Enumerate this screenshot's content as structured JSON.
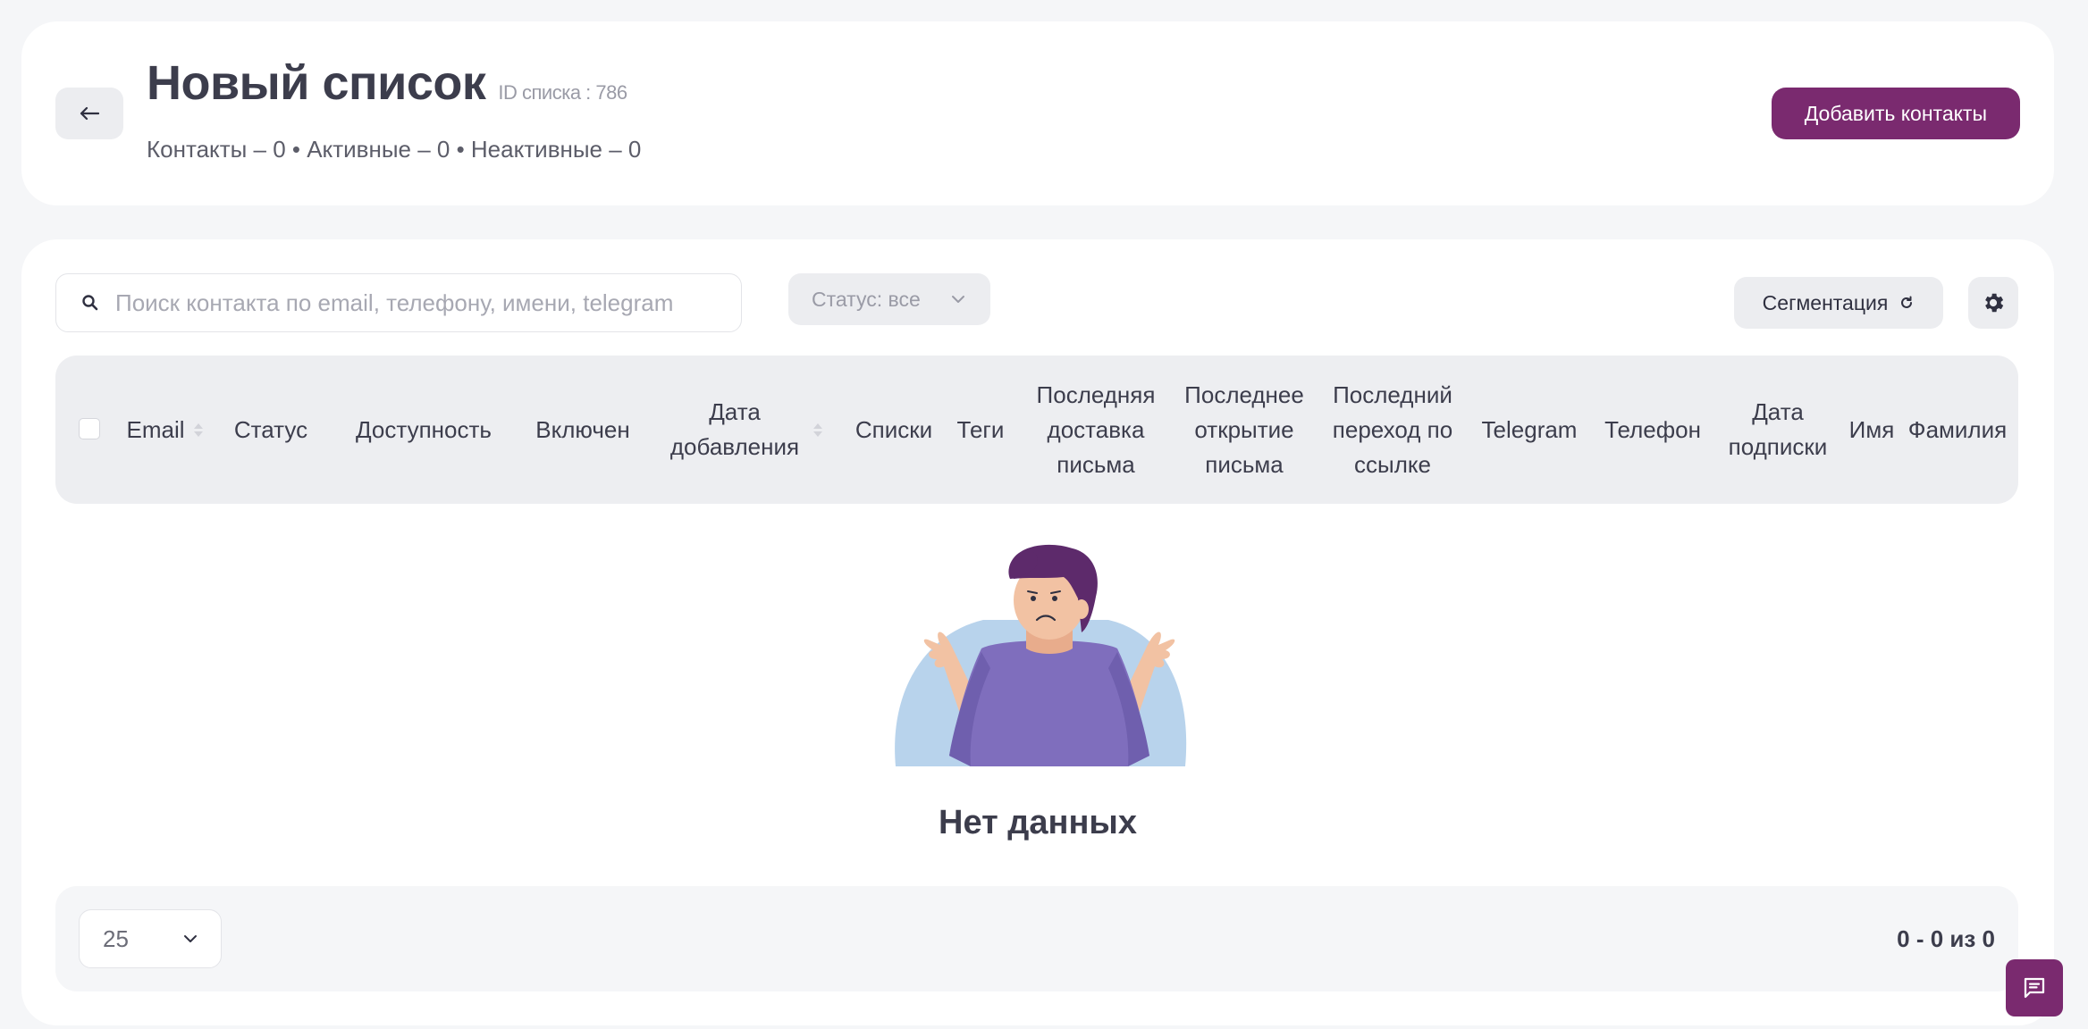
{
  "header": {
    "title": "Новый список",
    "list_id": "ID списка : 786",
    "counts": "Контакты – 0 • Активные – 0 • Неактивные – 0",
    "add_button": "Добавить контакты"
  },
  "toolbar": {
    "search_placeholder": "Поиск контакта по email, телефону, имени, telegram",
    "status_filter": "Статус: все",
    "segmentation_button": "Сегментация"
  },
  "table": {
    "columns": [
      {
        "label": "Email",
        "sortable": true
      },
      {
        "label": "Статус",
        "sortable": false
      },
      {
        "label": "Доступность",
        "sortable": false
      },
      {
        "label": "Включен",
        "sortable": false
      },
      {
        "label": "Дата добавления",
        "sortable": true
      },
      {
        "label": "Списки",
        "sortable": false
      },
      {
        "label": "Теги",
        "sortable": false
      },
      {
        "label": "Последняя доставка письма",
        "sortable": false
      },
      {
        "label": "Последнее открытие письма",
        "sortable": false
      },
      {
        "label": "Последний переход по ссылке",
        "sortable": false
      },
      {
        "label": "Telegram",
        "sortable": false
      },
      {
        "label": "Телефон",
        "sortable": false
      },
      {
        "label": "Дата подписки",
        "sortable": false
      },
      {
        "label": "Имя",
        "sortable": false
      },
      {
        "label": "Фамилия",
        "sortable": false
      }
    ],
    "empty_text": "Нет данных"
  },
  "pagination": {
    "page_size": "25",
    "range": "0 - 0 из 0"
  },
  "colors": {
    "accent": "#7a2a6f",
    "background": "#f5f6f8",
    "card": "#ffffff",
    "header_row": "#edeef1"
  }
}
